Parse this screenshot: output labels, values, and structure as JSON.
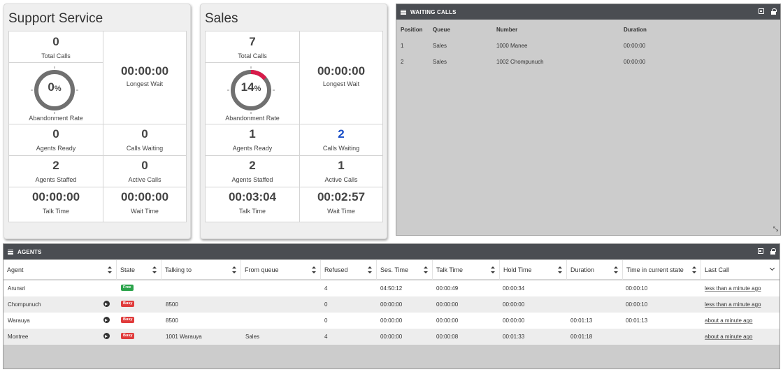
{
  "queues": [
    {
      "title": "Support Service",
      "total_calls": "0",
      "total_calls_label": "Total Calls",
      "abandonment_rate": "0",
      "abandonment_rate_unit": "%",
      "abandonment_fraction": 0.0,
      "abandonment_label": "Abandonment Rate",
      "longest_wait": "00:00:00",
      "longest_wait_label": "Longest Wait",
      "agents_ready": "0",
      "agents_ready_label": "Agents Ready",
      "calls_waiting": "0",
      "calls_waiting_label": "Calls Waiting",
      "agents_staffed": "2",
      "agents_staffed_label": "Agents Staffed",
      "active_calls": "0",
      "active_calls_label": "Active Calls",
      "talk_time": "00:00:00",
      "talk_time_label": "Talk Time",
      "wait_time": "00:00:00",
      "wait_time_label": "Wait Time"
    },
    {
      "title": "Sales",
      "total_calls": "7",
      "total_calls_label": "Total Calls",
      "abandonment_rate": "14",
      "abandonment_rate_unit": "%",
      "abandonment_fraction": 0.14,
      "abandonment_label": "Abandonment Rate",
      "longest_wait": "00:00:00",
      "longest_wait_label": "Longest Wait",
      "agents_ready": "1",
      "agents_ready_label": "Agents Ready",
      "calls_waiting": "2",
      "calls_waiting_label": "Calls Waiting",
      "agents_staffed": "2",
      "agents_staffed_label": "Agents Staffed",
      "active_calls": "1",
      "active_calls_label": "Active Calls",
      "talk_time": "00:03:04",
      "talk_time_label": "Talk Time",
      "wait_time": "00:02:57",
      "wait_time_label": "Wait Time"
    }
  ],
  "waiting_calls": {
    "title": "WAITING CALLS",
    "columns": [
      "Position",
      "Queue",
      "Number",
      "Duration"
    ],
    "rows": [
      [
        "1",
        "Sales",
        "1000 Manee",
        "00:00:00"
      ],
      [
        "2",
        "Sales",
        "1002 Chompunuch",
        "00:00:00"
      ]
    ]
  },
  "agents": {
    "title": "AGENTS",
    "columns": [
      "Agent",
      "State",
      "Talking to",
      "From queue",
      "Refused",
      "Ses. Time",
      "Talk Time",
      "Hold Time",
      "Duration",
      "Time in current state",
      "Last Call"
    ],
    "rows": [
      {
        "agent": "Arunsri",
        "state": "Free",
        "talking_to": "",
        "from_queue": "",
        "refused": "4",
        "ses_time": "04:50:12",
        "talk_time": "00:00:49",
        "hold_time": "00:00:34",
        "duration": "",
        "time_in_state": "00:00:10",
        "last_call": "less than a minute ago"
      },
      {
        "agent": "Chompunuch",
        "state": "Busy",
        "talking_to": "8500",
        "from_queue": "",
        "refused": "0",
        "ses_time": "00:00:00",
        "talk_time": "00:00:00",
        "hold_time": "00:00:00",
        "duration": "",
        "time_in_state": "00:00:10",
        "last_call": "less than a minute ago"
      },
      {
        "agent": "Warauya",
        "state": "Busy",
        "talking_to": "8500",
        "from_queue": "",
        "refused": "0",
        "ses_time": "00:00:00",
        "talk_time": "00:00:00",
        "hold_time": "00:00:00",
        "duration": "00:01:13",
        "time_in_state": "00:01:13",
        "last_call": "about a minute ago"
      },
      {
        "agent": "Montree",
        "state": "Busy",
        "talking_to": "1001 Warauya",
        "from_queue": "Sales",
        "refused": "4",
        "ses_time": "00:00:00",
        "talk_time": "00:00:08",
        "hold_time": "00:01:33",
        "duration": "00:01:18",
        "time_in_state": "",
        "last_call": "about a minute ago"
      }
    ]
  },
  "icons": {
    "menu": "menu-icon",
    "maximize": "maximize-icon",
    "lock": "lock-icon",
    "resize": "resize-handle-icon",
    "action": "circle-arrow-icon"
  },
  "colors": {
    "header_bg": "#4a4d52",
    "gauge_ring": "#707070",
    "gauge_fill": "#d81b4a",
    "free": "#2aa34a",
    "busy": "#e03b3b",
    "highlight": "#1a4fc7"
  }
}
